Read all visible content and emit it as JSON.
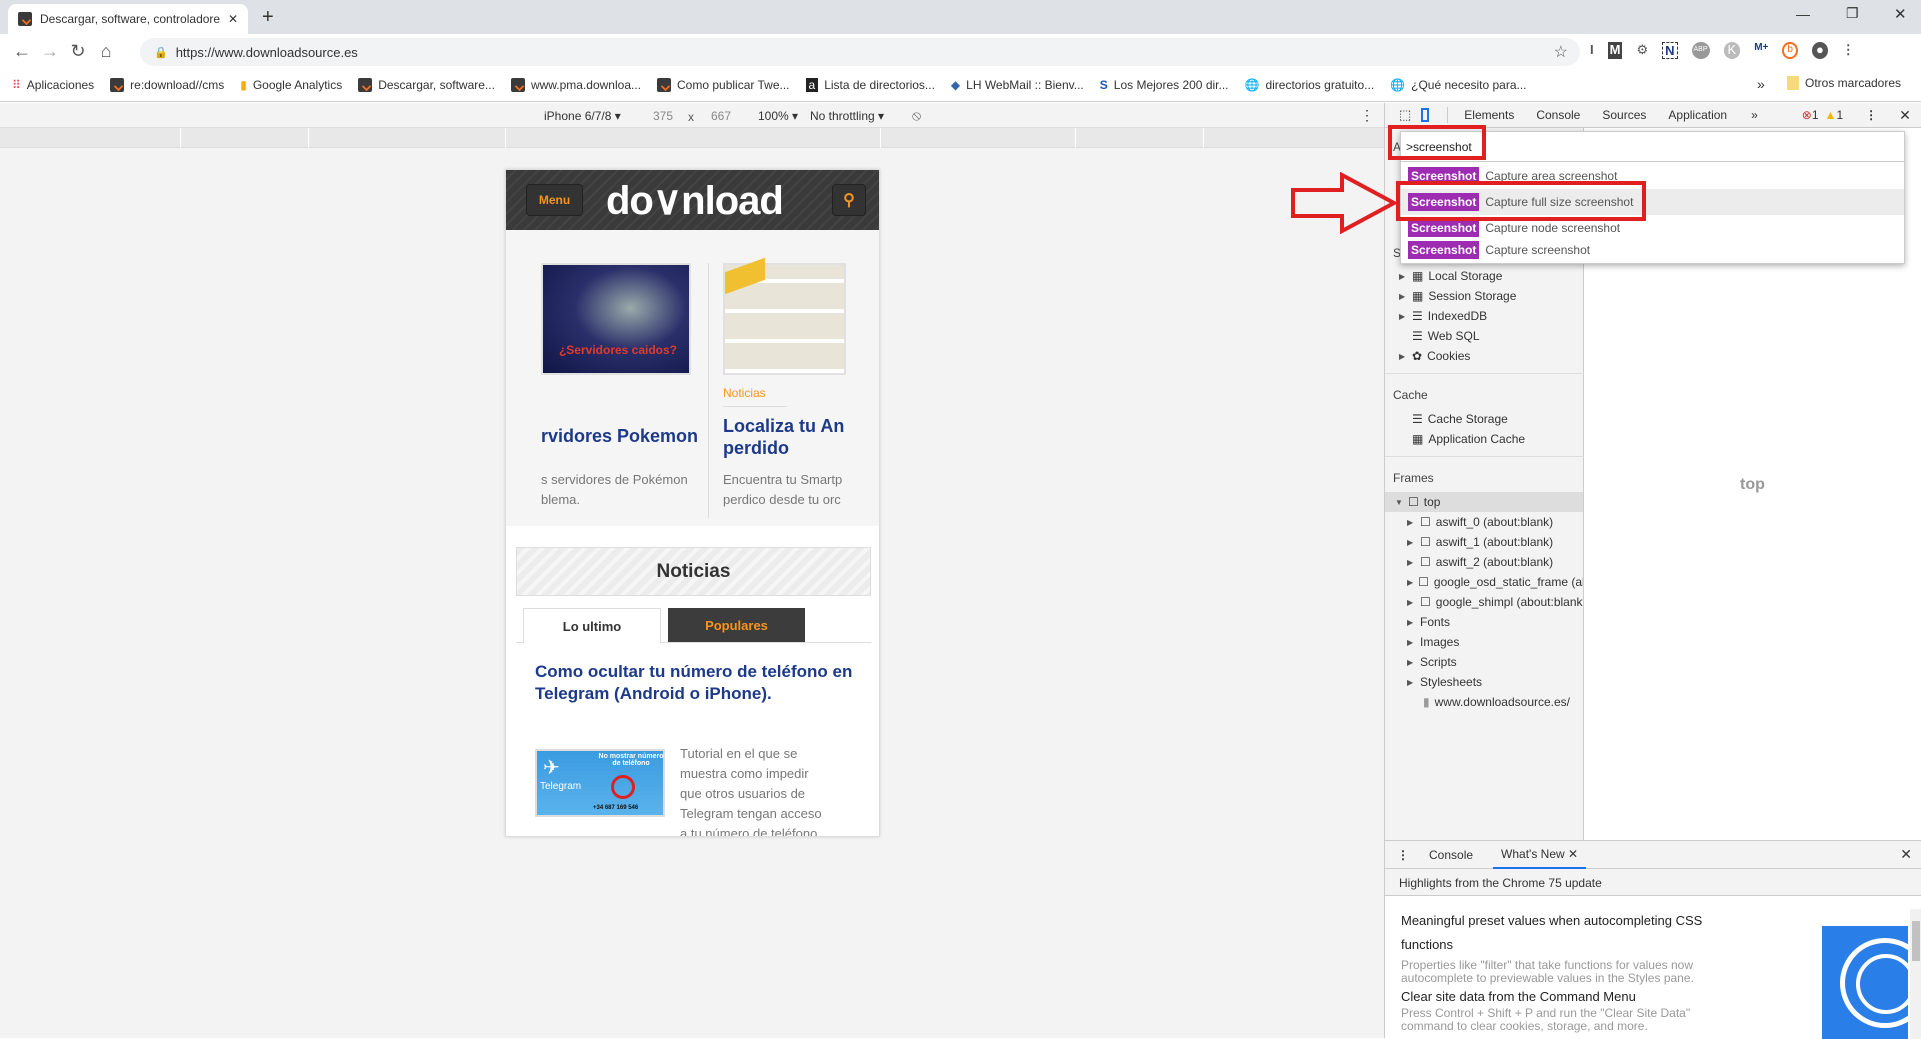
{
  "browser": {
    "tab_title": "Descargar, software, controladore",
    "url": "https://www.downloadsource.es",
    "bookmarks": [
      "Aplicaciones",
      "re:download//cms",
      "Google Analytics",
      "Descargar, software...",
      "www.pma.downloa...",
      "Como publicar Twe...",
      "Lista de directorios...",
      "LH WebMail :: Bienv...",
      "Los Mejores 200 dir...",
      "directorios gratuito...",
      "¿Qué necesito para..."
    ],
    "other_bookmarks": "Otros marcadores",
    "more_bookmarks": "»"
  },
  "device_toolbar": {
    "device": "iPhone 6/7/8",
    "width": "375",
    "sep": "x",
    "height": "667",
    "zoom": "100%",
    "throttling": "No throttling"
  },
  "site": {
    "menu_label": "Menu",
    "logo_text": "do∨nload",
    "cards": [
      {
        "image_caption": "¿Servidores caidos?",
        "category": "",
        "title": "rvidores Pokemon",
        "desc": "s servidores de Pokémon blema."
      },
      {
        "image_caption": "",
        "category": "Noticias",
        "title": "Localiza tu An perdido",
        "desc": "Encuentra tu Smartp perdico desde tu orc"
      }
    ],
    "section_title": "Noticias",
    "tabs": [
      "Lo ultimo",
      "Populares"
    ],
    "headline": "Como ocultar tu número de teléfono en Telegram (Android o iPhone).",
    "thumb": {
      "brand": "Telegram",
      "caption": "No mostrar número de teléfono",
      "phone": "+34 687 169 546"
    },
    "article_text": "Tutorial en el que se muestra como impedir que otros usuarios de Telegram tengan acceso a tu número de teléfono. De esta manera"
  },
  "devtools": {
    "tabs": [
      "Elements",
      "Console",
      "Sources",
      "Application"
    ],
    "more": "»",
    "errors": "1",
    "warnings": "1",
    "command_input": ">screenshot",
    "command_items": [
      {
        "badge": "Screenshot",
        "label": "Capture area screenshot"
      },
      {
        "badge": "Screenshot",
        "label": "Capture full size screenshot"
      },
      {
        "badge": "Screenshot",
        "label": "Capture node screenshot"
      },
      {
        "badge": "Screenshot",
        "label": "Capture screenshot"
      }
    ],
    "sidebar": {
      "hidden_header_a": "A",
      "hidden_header_st": "St",
      "storage": [
        "Local Storage",
        "Session Storage",
        "IndexedDB",
        "Web SQL",
        "Cookies"
      ],
      "cache_header": "Cache",
      "cache": [
        "Cache Storage",
        "Application Cache"
      ],
      "frames_header": "Frames",
      "top": "top",
      "frames": [
        "aswift_0 (about:blank)",
        "aswift_1 (about:blank)",
        "aswift_2 (about:blank)",
        "google_osd_static_frame (ab",
        "google_shimpl (about:blank",
        "Fonts",
        "Images",
        "Scripts",
        "Stylesheets"
      ],
      "resource": "www.downloadsource.es/"
    },
    "main_label": "top",
    "drawer": {
      "tabs": [
        "Console",
        "What's New"
      ],
      "highlight": "Highlights from the Chrome 75 update",
      "items": [
        {
          "title": "Meaningful preset values when autocompleting CSS functions",
          "desc": "Properties like \"filter\" that take functions for values now autocomplete to previewable values in the Styles pane."
        },
        {
          "title": "Clear site data from the Command Menu",
          "desc": "Press Control + Shift + P and run the \"Clear Site Data\" command to clear cookies, storage, and more."
        }
      ]
    }
  },
  "colors": {
    "accent_orange": "#f7941d",
    "badge_purple": "#9e2cb2",
    "annotation_red": "#e02020",
    "link_blue": "#1d3a8a"
  }
}
